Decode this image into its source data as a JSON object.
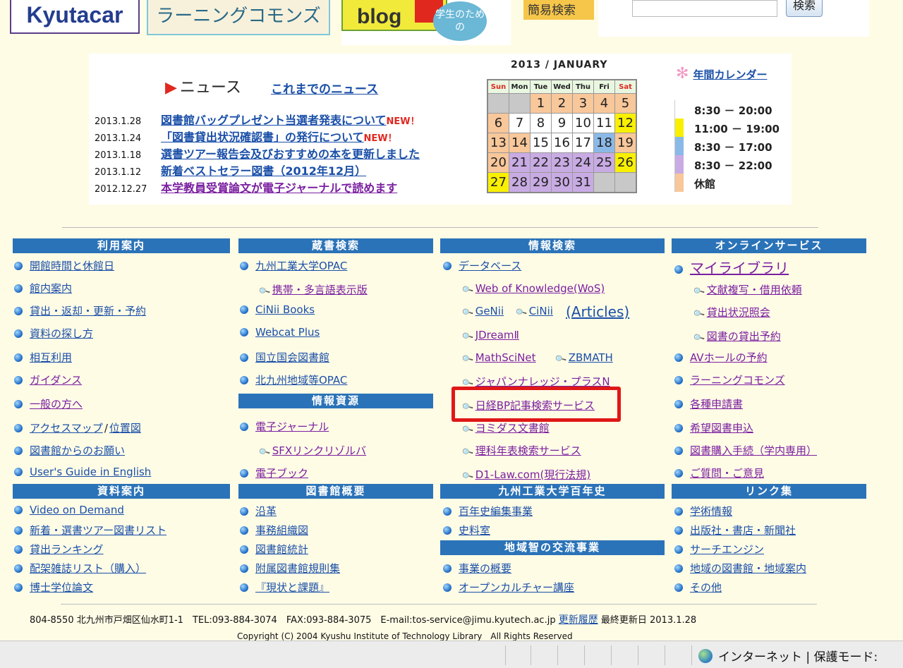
{
  "banner": {
    "logo_kyutacar": "Kyutacar",
    "logo_learning_commons": "ラーニングコモンズ",
    "blog_label": "blog",
    "blog_bubble": "学生のための",
    "simple_search": "簡易検索",
    "search_button": "検索"
  },
  "news": {
    "heading": "ニュース",
    "past_news_link": "これまでのニュース",
    "new_badge": "NEW！",
    "items": [
      {
        "date": "2013.1.28",
        "title": "図書館バッグプレゼント当選者発表について",
        "new": true
      },
      {
        "date": "2013.1.24",
        "title": "「図書貸出状況確認書」の発行について",
        "new": true
      },
      {
        "date": "2013.1.18",
        "title": "選書ツアー報告会及びおすすめの本を更新しました",
        "new": false
      },
      {
        "date": "2013.1.12",
        "title": "新着ベストセラー図書（2012年12月）",
        "new": false
      },
      {
        "date": "2012.12.27",
        "title": "本学教員受賞論文が電子ジャーナルで読めます",
        "new": false
      }
    ]
  },
  "calendar": {
    "title": "2013 / JANUARY",
    "weekdays": [
      "Sun",
      "Mon",
      "Tue",
      "Wed",
      "Thu",
      "Fri",
      "Sat"
    ],
    "weeks": [
      [
        {
          "d": "",
          "c": "empty"
        },
        {
          "d": "",
          "c": "empty"
        },
        {
          "d": "1",
          "c": "or"
        },
        {
          "d": "2",
          "c": "or"
        },
        {
          "d": "3",
          "c": "or"
        },
        {
          "d": "4",
          "c": "or"
        },
        {
          "d": "5",
          "c": "or"
        }
      ],
      [
        {
          "d": "6",
          "c": "or"
        },
        {
          "d": "7",
          "c": "wh"
        },
        {
          "d": "8",
          "c": "wh"
        },
        {
          "d": "9",
          "c": "wh"
        },
        {
          "d": "10",
          "c": "wh"
        },
        {
          "d": "11",
          "c": "wh"
        },
        {
          "d": "12",
          "c": "ye"
        }
      ],
      [
        {
          "d": "13",
          "c": "or"
        },
        {
          "d": "14",
          "c": "or"
        },
        {
          "d": "15",
          "c": "wh"
        },
        {
          "d": "16",
          "c": "wh"
        },
        {
          "d": "17",
          "c": "wh"
        },
        {
          "d": "18",
          "c": "bl"
        },
        {
          "d": "19",
          "c": "or"
        }
      ],
      [
        {
          "d": "20",
          "c": "or"
        },
        {
          "d": "21",
          "c": "pu"
        },
        {
          "d": "22",
          "c": "pu"
        },
        {
          "d": "23",
          "c": "pu"
        },
        {
          "d": "24",
          "c": "pu"
        },
        {
          "d": "25",
          "c": "pu"
        },
        {
          "d": "26",
          "c": "ye"
        }
      ],
      [
        {
          "d": "27",
          "c": "ye"
        },
        {
          "d": "28",
          "c": "pu"
        },
        {
          "d": "29",
          "c": "pu"
        },
        {
          "d": "30",
          "c": "pu"
        },
        {
          "d": "31",
          "c": "pu"
        },
        {
          "d": "",
          "c": "empty"
        },
        {
          "d": "",
          "c": "empty"
        }
      ]
    ],
    "year_calendar_link": "年間カレンダー",
    "legend": [
      {
        "color": "#ffffff",
        "text": "8:30 － 20:00"
      },
      {
        "color": "#f8f000",
        "text": "11:00 － 19:00"
      },
      {
        "color": "#8ab9e8",
        "text": "8:30 － 17:00"
      },
      {
        "color": "#c9abe4",
        "text": "8:30 － 22:00"
      },
      {
        "color": "#f8c79a",
        "text": "休館"
      }
    ]
  },
  "sections": {
    "usage": {
      "title": "利用案内",
      "items": [
        "開館時間と休館日",
        "館内案内",
        "貸出・返却・更新・予約",
        "資料の探し方",
        "相互利用",
        "ガイダンス",
        "一般の方へ",
        "アクセスマップ",
        "位置図",
        "図書館からのお願い",
        "User's Guide in English"
      ]
    },
    "materials": {
      "title": "資料案内",
      "items": [
        "Video on Demand",
        "新着・選書ツアー図書リスト",
        "貸出ランキング",
        "配架雑誌リスト（購入）",
        "博士学位論文"
      ]
    },
    "holdings": {
      "title": "蔵書検索",
      "items": [
        "九州工業大学OPAC",
        "携帯・多言語表示版",
        "CiNii Books",
        "Webcat Plus",
        "国立国会図書館",
        "北九州地域等OPAC"
      ]
    },
    "resources": {
      "title": "情報資源",
      "items": [
        "電子ジャーナル",
        "SFXリンクリゾルバ",
        "電子ブック"
      ]
    },
    "overview": {
      "title": "図書館概要",
      "items": [
        "沿革",
        "事務組織図",
        "図書館統計",
        "附属図書館規則集",
        "『現状と課題』"
      ]
    },
    "info_search": {
      "title": "情報検索",
      "items": [
        "データベース",
        "Web of Knowledge(WoS)",
        "GeNii",
        "CiNii",
        "(Articles)",
        "JDreamⅡ",
        "MathSciNet",
        "ZBMATH",
        "ジャパンナレッジ・プラスN",
        "日経BP記事検索サービス",
        "ヨミダス文書館",
        "理科年表検索サービス",
        "D1-Law.com(現行法規)"
      ]
    },
    "history": {
      "title": "九州工業大学百年史",
      "items": [
        "百年史編集事業",
        "史料室"
      ]
    },
    "exchange": {
      "title": "地域智の交流事業",
      "items": [
        "事業の概要",
        "オープンカルチャー講座"
      ]
    },
    "online": {
      "title": "オンラインサービス",
      "items": [
        "マイライブラリ",
        "文献複写・借用依頼",
        "貸出状況照会",
        "図書の貸出予約",
        "AVホールの予約",
        "ラーニングコモンズ",
        "各種申請書",
        "希望図書申込",
        "図書購入手続（学内専用）",
        "ご質問・ご意見"
      ]
    },
    "links": {
      "title": "リンク集",
      "items": [
        "学術情報",
        "出版社・書店・新聞社",
        "サーチエンジン",
        "地域の図書館・地域案内",
        "その他"
      ]
    }
  },
  "footer": {
    "address": "804-8550 北九州市戸畑区仙水町1-1　TEL:093-884-3074　FAX:093-884-3075　E-mail:tos-service@jimu.kyutech.ac.jp",
    "update_history": "更新履歴",
    "last_updated_label": "最終更新日",
    "last_updated": "2013.1.28",
    "copyright": "Copyright (C) 2004 Kyushu Institute of Technology Library　All Rights Reserved"
  },
  "statusbar": {
    "zone": "インターネット | 保護モード:"
  }
}
